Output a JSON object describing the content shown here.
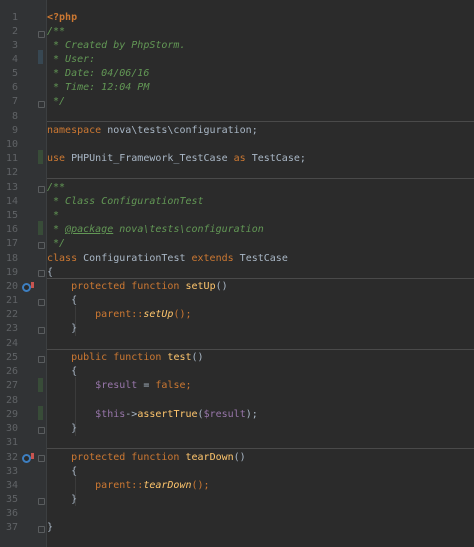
{
  "editor": {
    "line_numbers": [
      "1",
      "2",
      "3",
      "4",
      "5",
      "6",
      "7",
      "8",
      "9",
      "10",
      "11",
      "12",
      "13",
      "14",
      "15",
      "16",
      "17",
      "18",
      "19",
      "20",
      "21",
      "22",
      "23",
      "24",
      "25",
      "26",
      "27",
      "28",
      "29",
      "30",
      "31",
      "32",
      "33",
      "34",
      "35",
      "36",
      "37"
    ],
    "lines": {
      "l1": "<?php",
      "l2": "/**",
      "l3": " * Created by PhpStorm.",
      "l4": " * User:",
      "l5": " * Date: 04/06/16",
      "l6": " * Time: 12:04 PM",
      "l7": " */",
      "l9a": "namespace",
      "l9b": " nova\\tests\\configuration;",
      "l11a": "use",
      "l11b": " PHPUnit_Framework_TestCase ",
      "l11c": "as",
      "l11d": " TestCase;",
      "l13": "/**",
      "l14": " * Class ConfigurationTest",
      "l15": " *",
      "l16a": " * ",
      "l16b": "@package",
      "l16c": " nova\\tests\\configuration",
      "l17": " */",
      "l18a": "class",
      "l18b": " ConfigurationTest ",
      "l18c": "extends",
      "l18d": " TestCase",
      "l19": "{",
      "l20a": "    protected function ",
      "l20b": "setUp",
      "l20c": "()",
      "l21": "    {",
      "l22a": "        parent::",
      "l22b": "setUp",
      "l22c": "();",
      "l23": "    }",
      "l25a": "    public function ",
      "l25b": "test",
      "l25c": "()",
      "l26": "    {",
      "l27a": "        ",
      "l27b": "$result",
      "l27c": " = ",
      "l27d": "false",
      "l27e": ";",
      "l29a": "        ",
      "l29b": "$this",
      "l29c": "->",
      "l29d": "assertTrue",
      "l29e": "(",
      "l29f": "$result",
      "l29g": ");",
      "l30": "    }",
      "l32a": "    protected function ",
      "l32b": "tearDown",
      "l32c": "()",
      "l33": "    {",
      "l34a": "        parent::",
      "l34b": "tearDown",
      "l34c": "();",
      "l35": "    }",
      "l37": "}"
    },
    "colors": {
      "background": "#2b2b2b",
      "keyword": "#cc7832",
      "comment": "#629755",
      "plain": "#a9b7c6",
      "variable": "#9876aa",
      "function": "#ffc66d"
    }
  }
}
